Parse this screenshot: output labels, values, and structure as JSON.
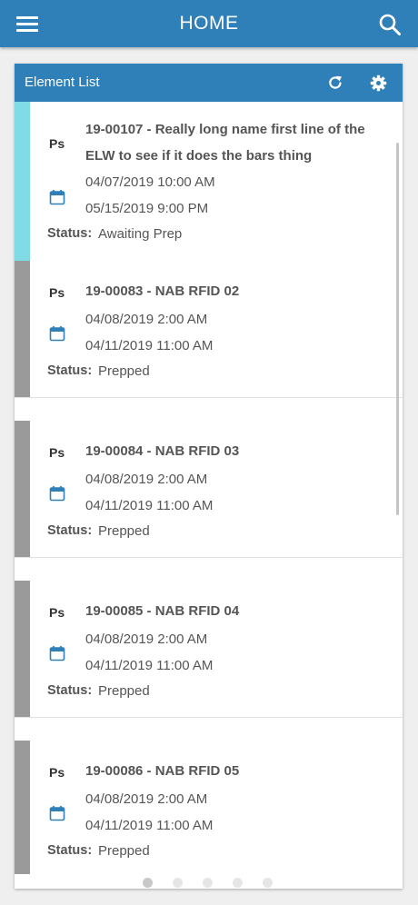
{
  "app": {
    "title": "HOME"
  },
  "panel": {
    "title": "Element List"
  },
  "items": [
    {
      "badge": "Ps",
      "title": "19-00107 - Really long name first line of the ELW to see if it does the bars thing",
      "start": "04/07/2019 10:00 AM",
      "end": "05/15/2019 9:00 PM",
      "status_label": "Status:",
      "status": "Awaiting Prep",
      "stripe_color": "#7fdbe6"
    },
    {
      "badge": "Ps",
      "title": "19-00083 - NAB RFID 02",
      "start": "04/08/2019 2:00 AM",
      "end": "04/11/2019 11:00 AM",
      "status_label": "Status:",
      "status": "Prepped",
      "stripe_color": "#9a9a9a"
    },
    {
      "badge": "Ps",
      "title": "19-00084 - NAB RFID 03",
      "start": "04/08/2019 2:00 AM",
      "end": "04/11/2019 11:00 AM",
      "status_label": "Status:",
      "status": "Prepped",
      "stripe_color": "#9a9a9a"
    },
    {
      "badge": "Ps",
      "title": "19-00085 - NAB RFID 04",
      "start": "04/08/2019 2:00 AM",
      "end": "04/11/2019 11:00 AM",
      "status_label": "Status:",
      "status": "Prepped",
      "stripe_color": "#9a9a9a"
    },
    {
      "badge": "Ps",
      "title": "19-00086 - NAB RFID 05",
      "start": "04/08/2019 2:00 AM",
      "end": "04/11/2019 11:00 AM",
      "status_label": "Status:",
      "status": "Prepped",
      "stripe_color": "#9a9a9a"
    }
  ],
  "pager": {
    "pages": 5,
    "active": 0
  },
  "icons": {
    "menu": "hamburger-menu-icon",
    "search": "search-icon",
    "refresh": "refresh-icon",
    "settings": "gear-icon",
    "calendar": "calendar-icon"
  }
}
